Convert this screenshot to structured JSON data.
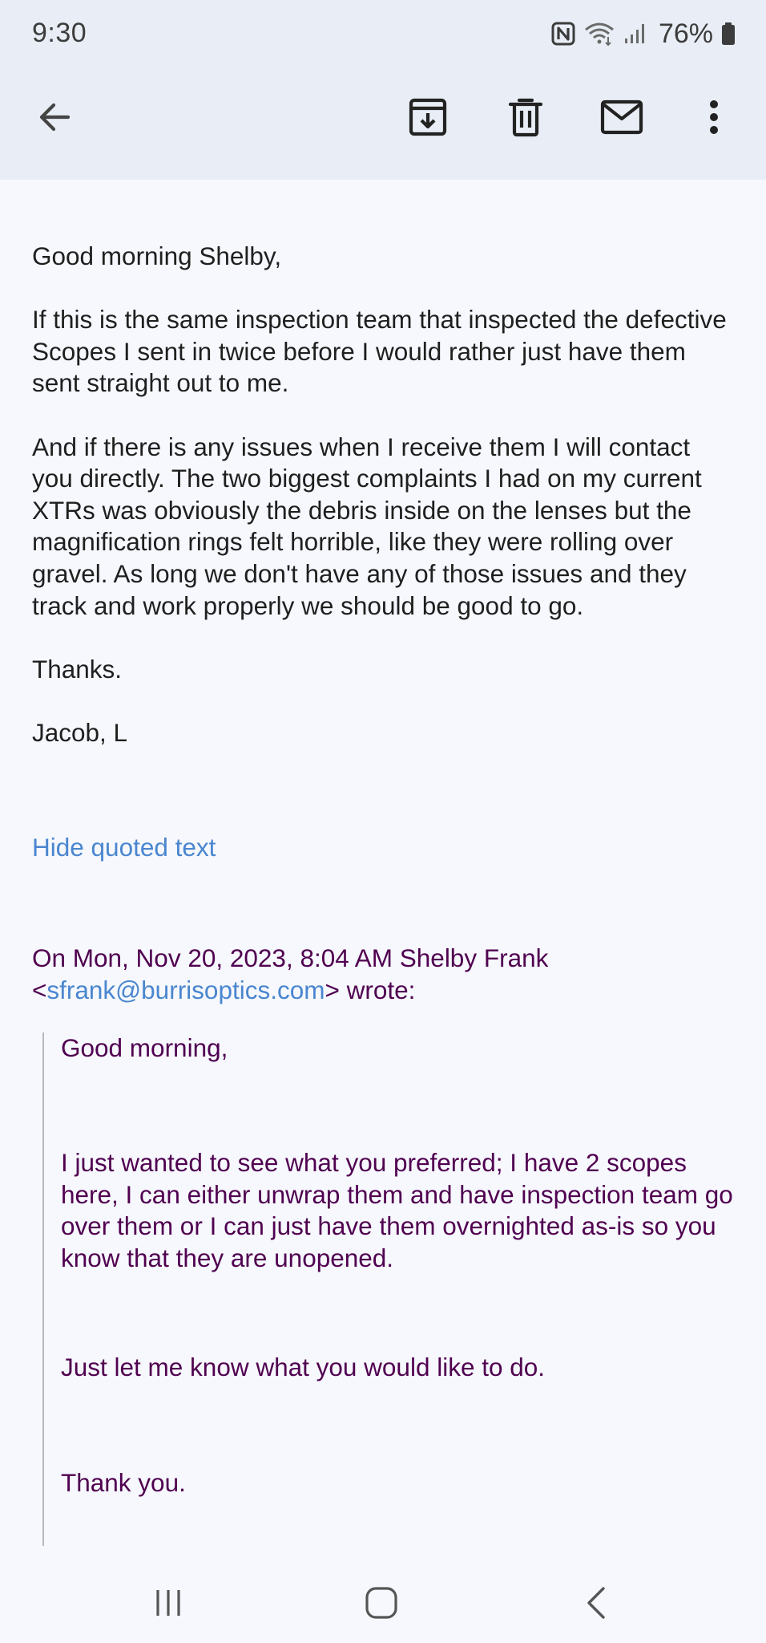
{
  "status_bar": {
    "time": "9:30",
    "battery_percent": "76%",
    "icons": [
      "nfc-icon",
      "wifi-icon",
      "signal-icon",
      "battery-icon"
    ]
  },
  "app_bar": {
    "actions": [
      "back-arrow-icon",
      "archive-icon",
      "delete-icon",
      "mark-unread-icon",
      "more-vert-icon"
    ]
  },
  "message": {
    "greeting": "Good morning Shelby,",
    "paragraph_1": "If this is the same inspection team that inspected the defective Scopes I sent in twice before I would rather just have them sent straight out to me.",
    "paragraph_2": "And if there is any issues when I receive them I will contact you directly. The two biggest complaints I had on my current XTRs was obviously the debris inside on the lenses but the magnification rings felt horrible, like they were rolling over gravel. As long we don't have any of those issues and they track and work properly we should be good to go.",
    "thanks": "Thanks.",
    "signature": "Jacob, L",
    "hide_quoted": "Hide quoted text"
  },
  "quoted": {
    "attribution_prefix": "On Mon, Nov 20, 2023, 8:04 AM Shelby Frank",
    "open_bracket": "<",
    "email": "sfrank@burrisoptics.com",
    "attribution_suffix": "> wrote:",
    "line_1": "Good morning,",
    "line_2": "I just wanted to see what you preferred; I have 2 scopes here, I can either unwrap them and have inspection team go over them or I can just have them overnighted as-is so you know that they are unopened.",
    "line_3": "Just let me know what you would like to do.",
    "line_4": "Thank you."
  },
  "colors": {
    "chrome_bg": "#e9eef6",
    "page_bg": "#f6f8fd",
    "link": "#4a86cf",
    "quoted_text": "#500050"
  },
  "nav_bar": {
    "buttons": [
      "recents-icon",
      "home-icon",
      "back-icon"
    ]
  }
}
